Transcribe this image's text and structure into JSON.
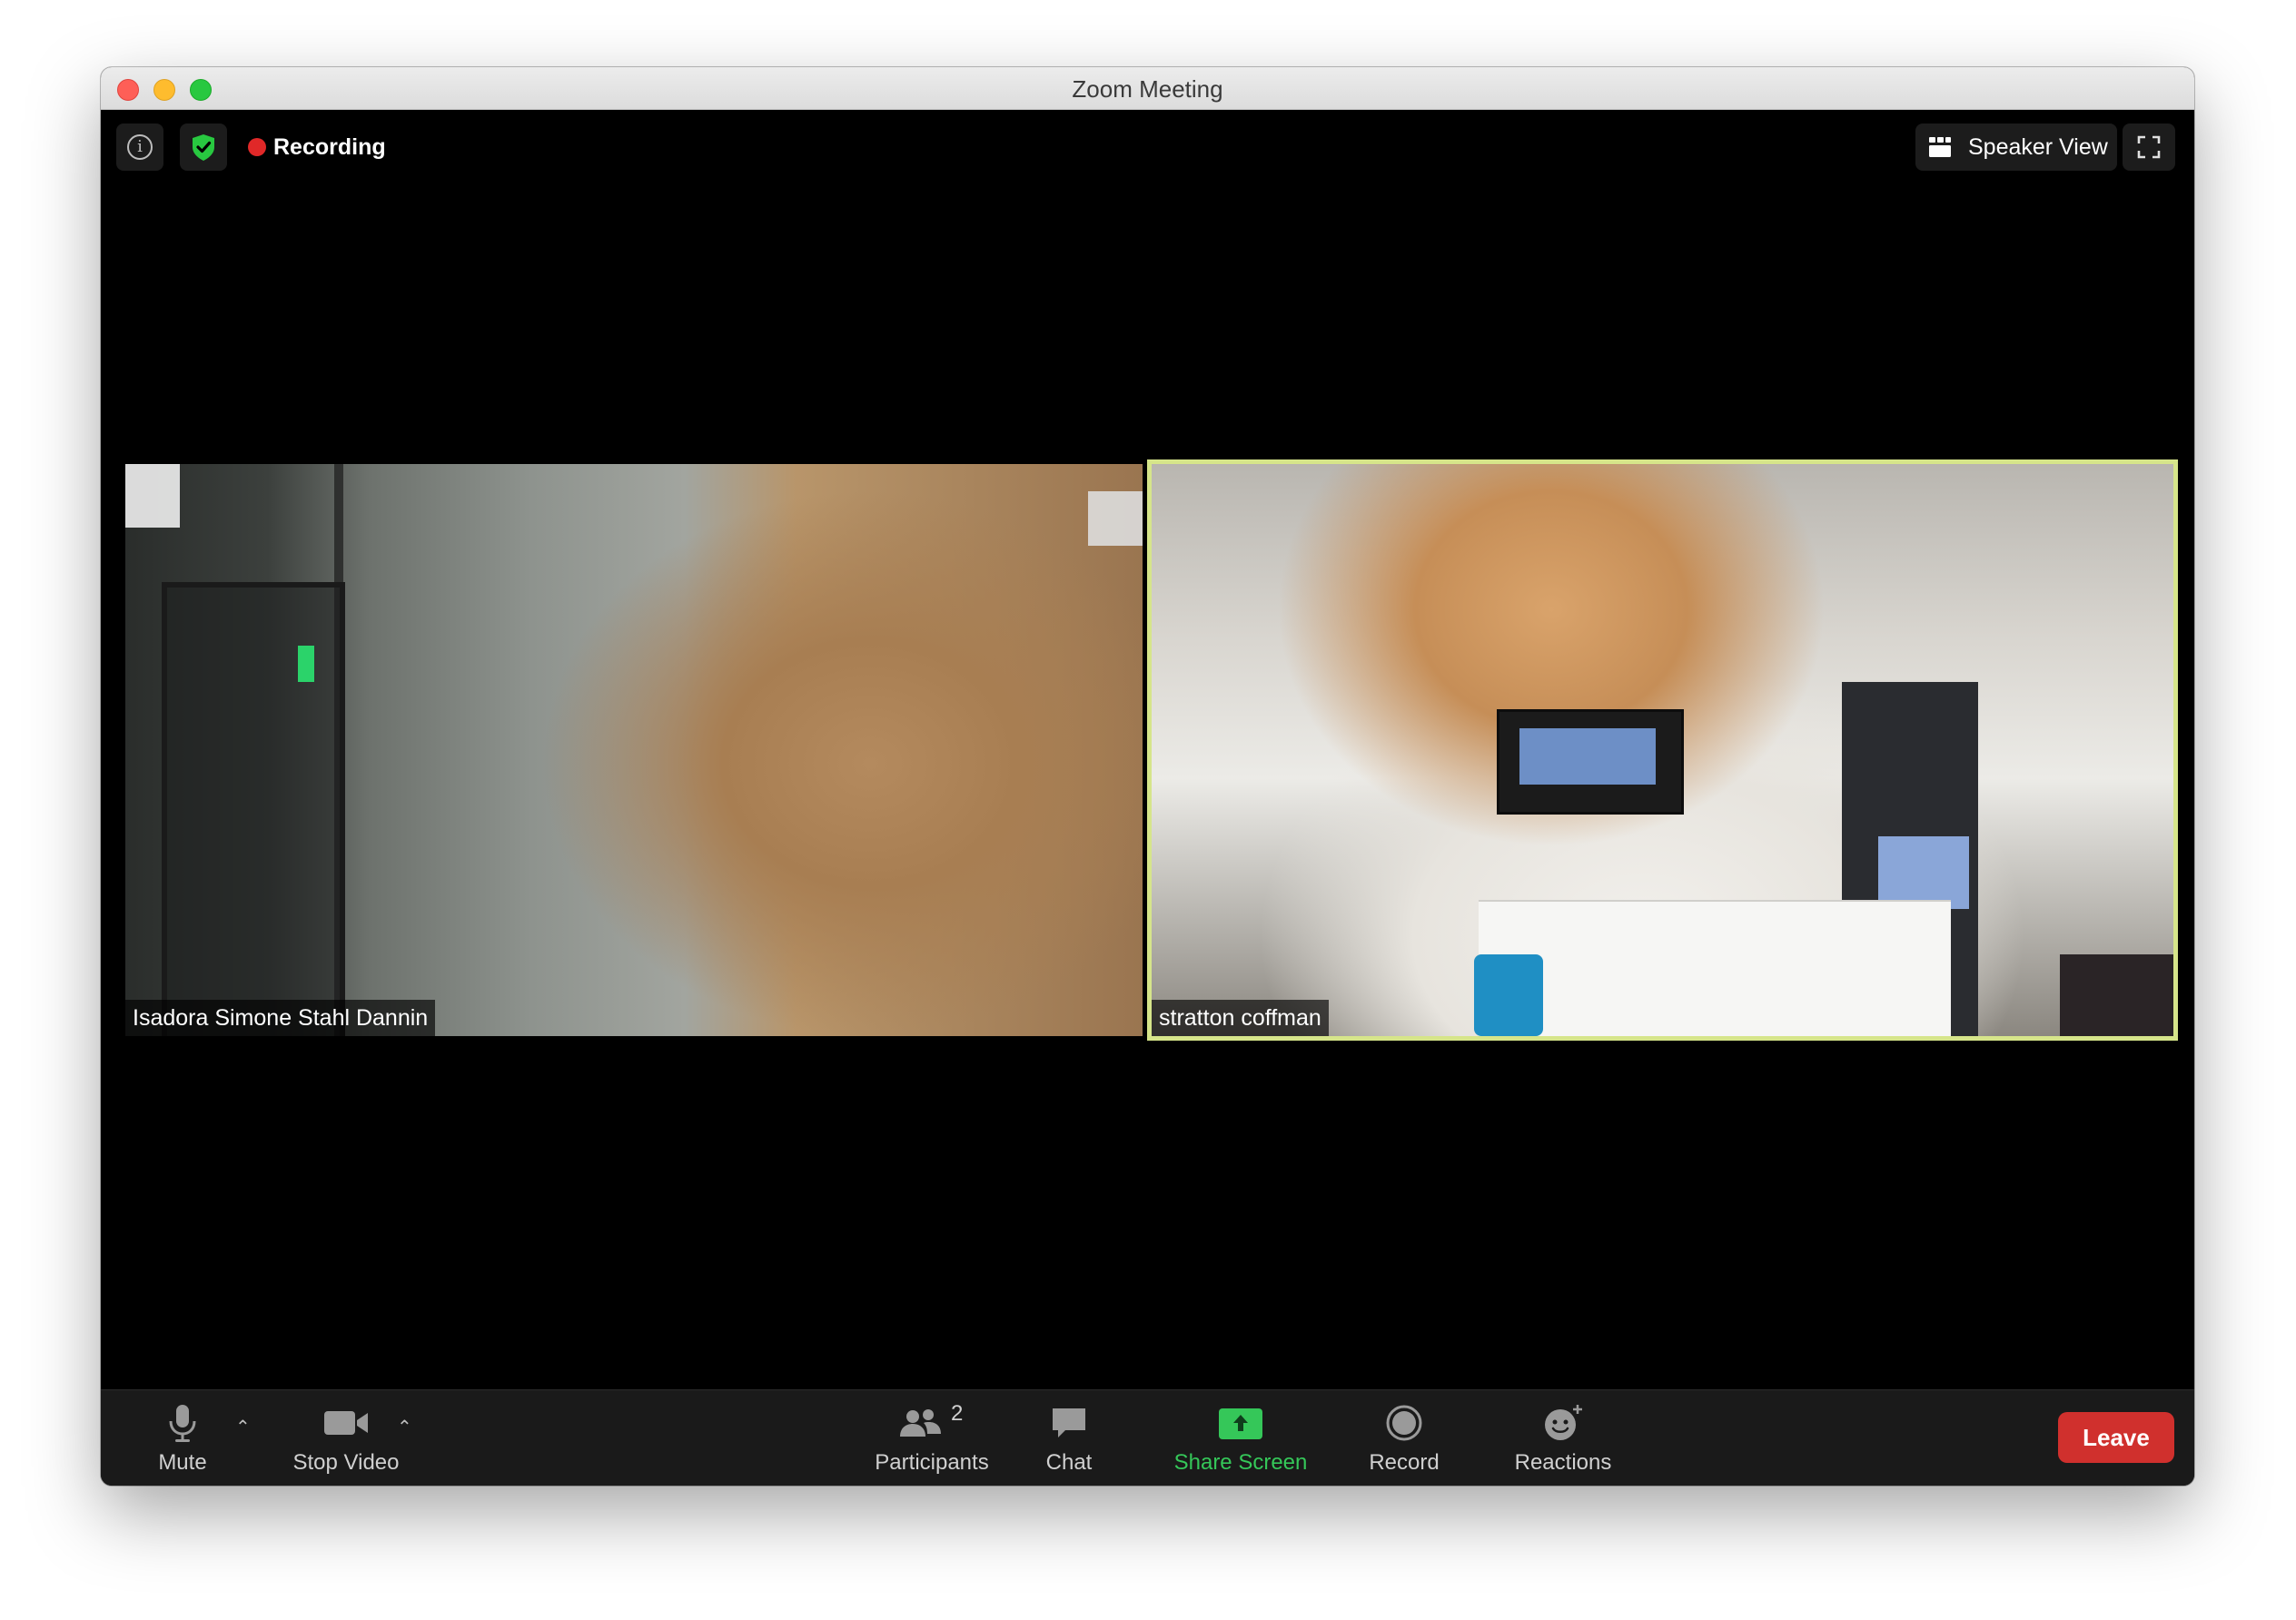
{
  "window": {
    "title": "Zoom Meeting"
  },
  "top_bar": {
    "info_icon": "info-icon",
    "security_icon": "shield-check-icon",
    "recording_label": "Recording",
    "view_label": "Speaker View",
    "fullscreen_icon": "fullscreen-icon"
  },
  "participants": [
    {
      "name": "Isadora Simone Stahl Dannin",
      "active_speaker": false
    },
    {
      "name": "stratton coffman",
      "active_speaker": true
    }
  ],
  "toolbar": {
    "mute_label": "Mute",
    "video_label": "Stop Video",
    "participants_label": "Participants",
    "participants_count": "2",
    "chat_label": "Chat",
    "share_label": "Share Screen",
    "record_label": "Record",
    "reactions_label": "Reactions",
    "leave_label": "Leave"
  },
  "colors": {
    "active_speaker_border": "#d6e58a",
    "share_green": "#35c759",
    "leave_red": "#d0302d",
    "recording_red": "#e02828"
  }
}
